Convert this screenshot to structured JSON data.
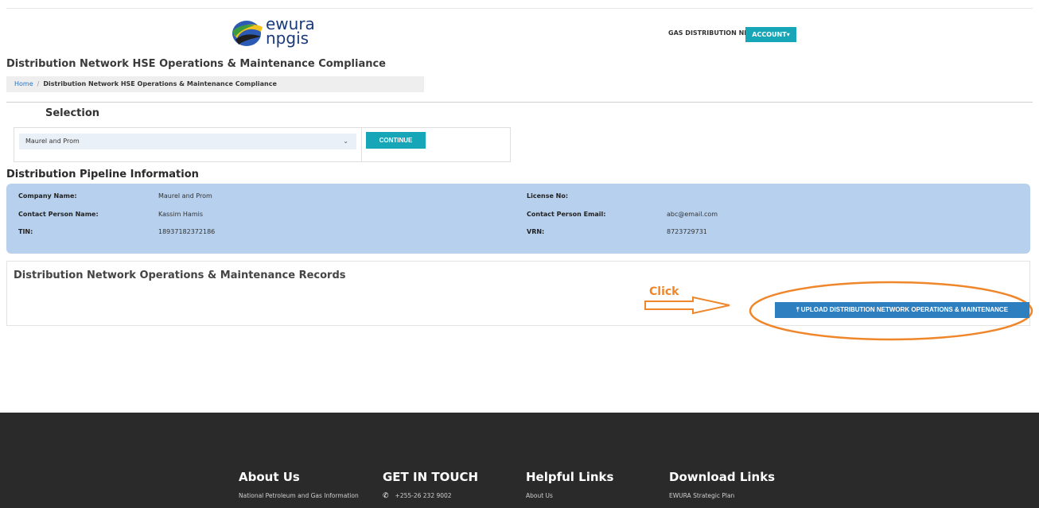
{
  "logo": {
    "line1": "ewura",
    "line2": "npgis"
  },
  "header": {
    "nav_gas": "GAS DISTRIBUTION NETWORKS",
    "account": "ACCOUNT"
  },
  "page": {
    "title": "Distribution Network HSE Operations & Maintenance Compliance"
  },
  "breadcrumb": {
    "home": "Home",
    "separator": "/",
    "current": "Distribution Network HSE Operations & Maintenance Compliance"
  },
  "selection": {
    "title": "Selection",
    "selected": "Maurel and Prom",
    "continue": "CONTINUE"
  },
  "info": {
    "title": "Distribution Pipeline Information",
    "company_label": "Company Name:",
    "company": "Maurel and Prom",
    "license_label": "License No:",
    "license": "",
    "contact_label": "Contact Person Name:",
    "contact": "Kassim Hamis",
    "email_label": "Contact Person Email:",
    "email": "abc@email.com",
    "tin_label": "TIN:",
    "tin": "18937182372186",
    "vrn_label": "VRN:",
    "vrn": "8723729731"
  },
  "records": {
    "title": "Distribution Network Operations & Maintenance Records",
    "click_label": "Click",
    "upload": "UPLOAD DISTRIBUTION NETWORK OPERATIONS & MAINTENANCE"
  },
  "footer": {
    "about_title": "About Us",
    "about_text": "National Petroleum and Gas Information",
    "contact_title": "GET IN TOUCH",
    "phone": "+255-26 232 9002",
    "helpful_title": "Helpful Links",
    "helpful_1": "About Us",
    "download_title": "Download Links",
    "download_1": "EWURA Strategic Plan"
  },
  "colors": {
    "accent": "#17a6b8",
    "upload": "#2e7fbf",
    "info_bg": "#b6d0ee",
    "annotation": "#f0862a",
    "footer_bg": "#2a2a2a"
  }
}
